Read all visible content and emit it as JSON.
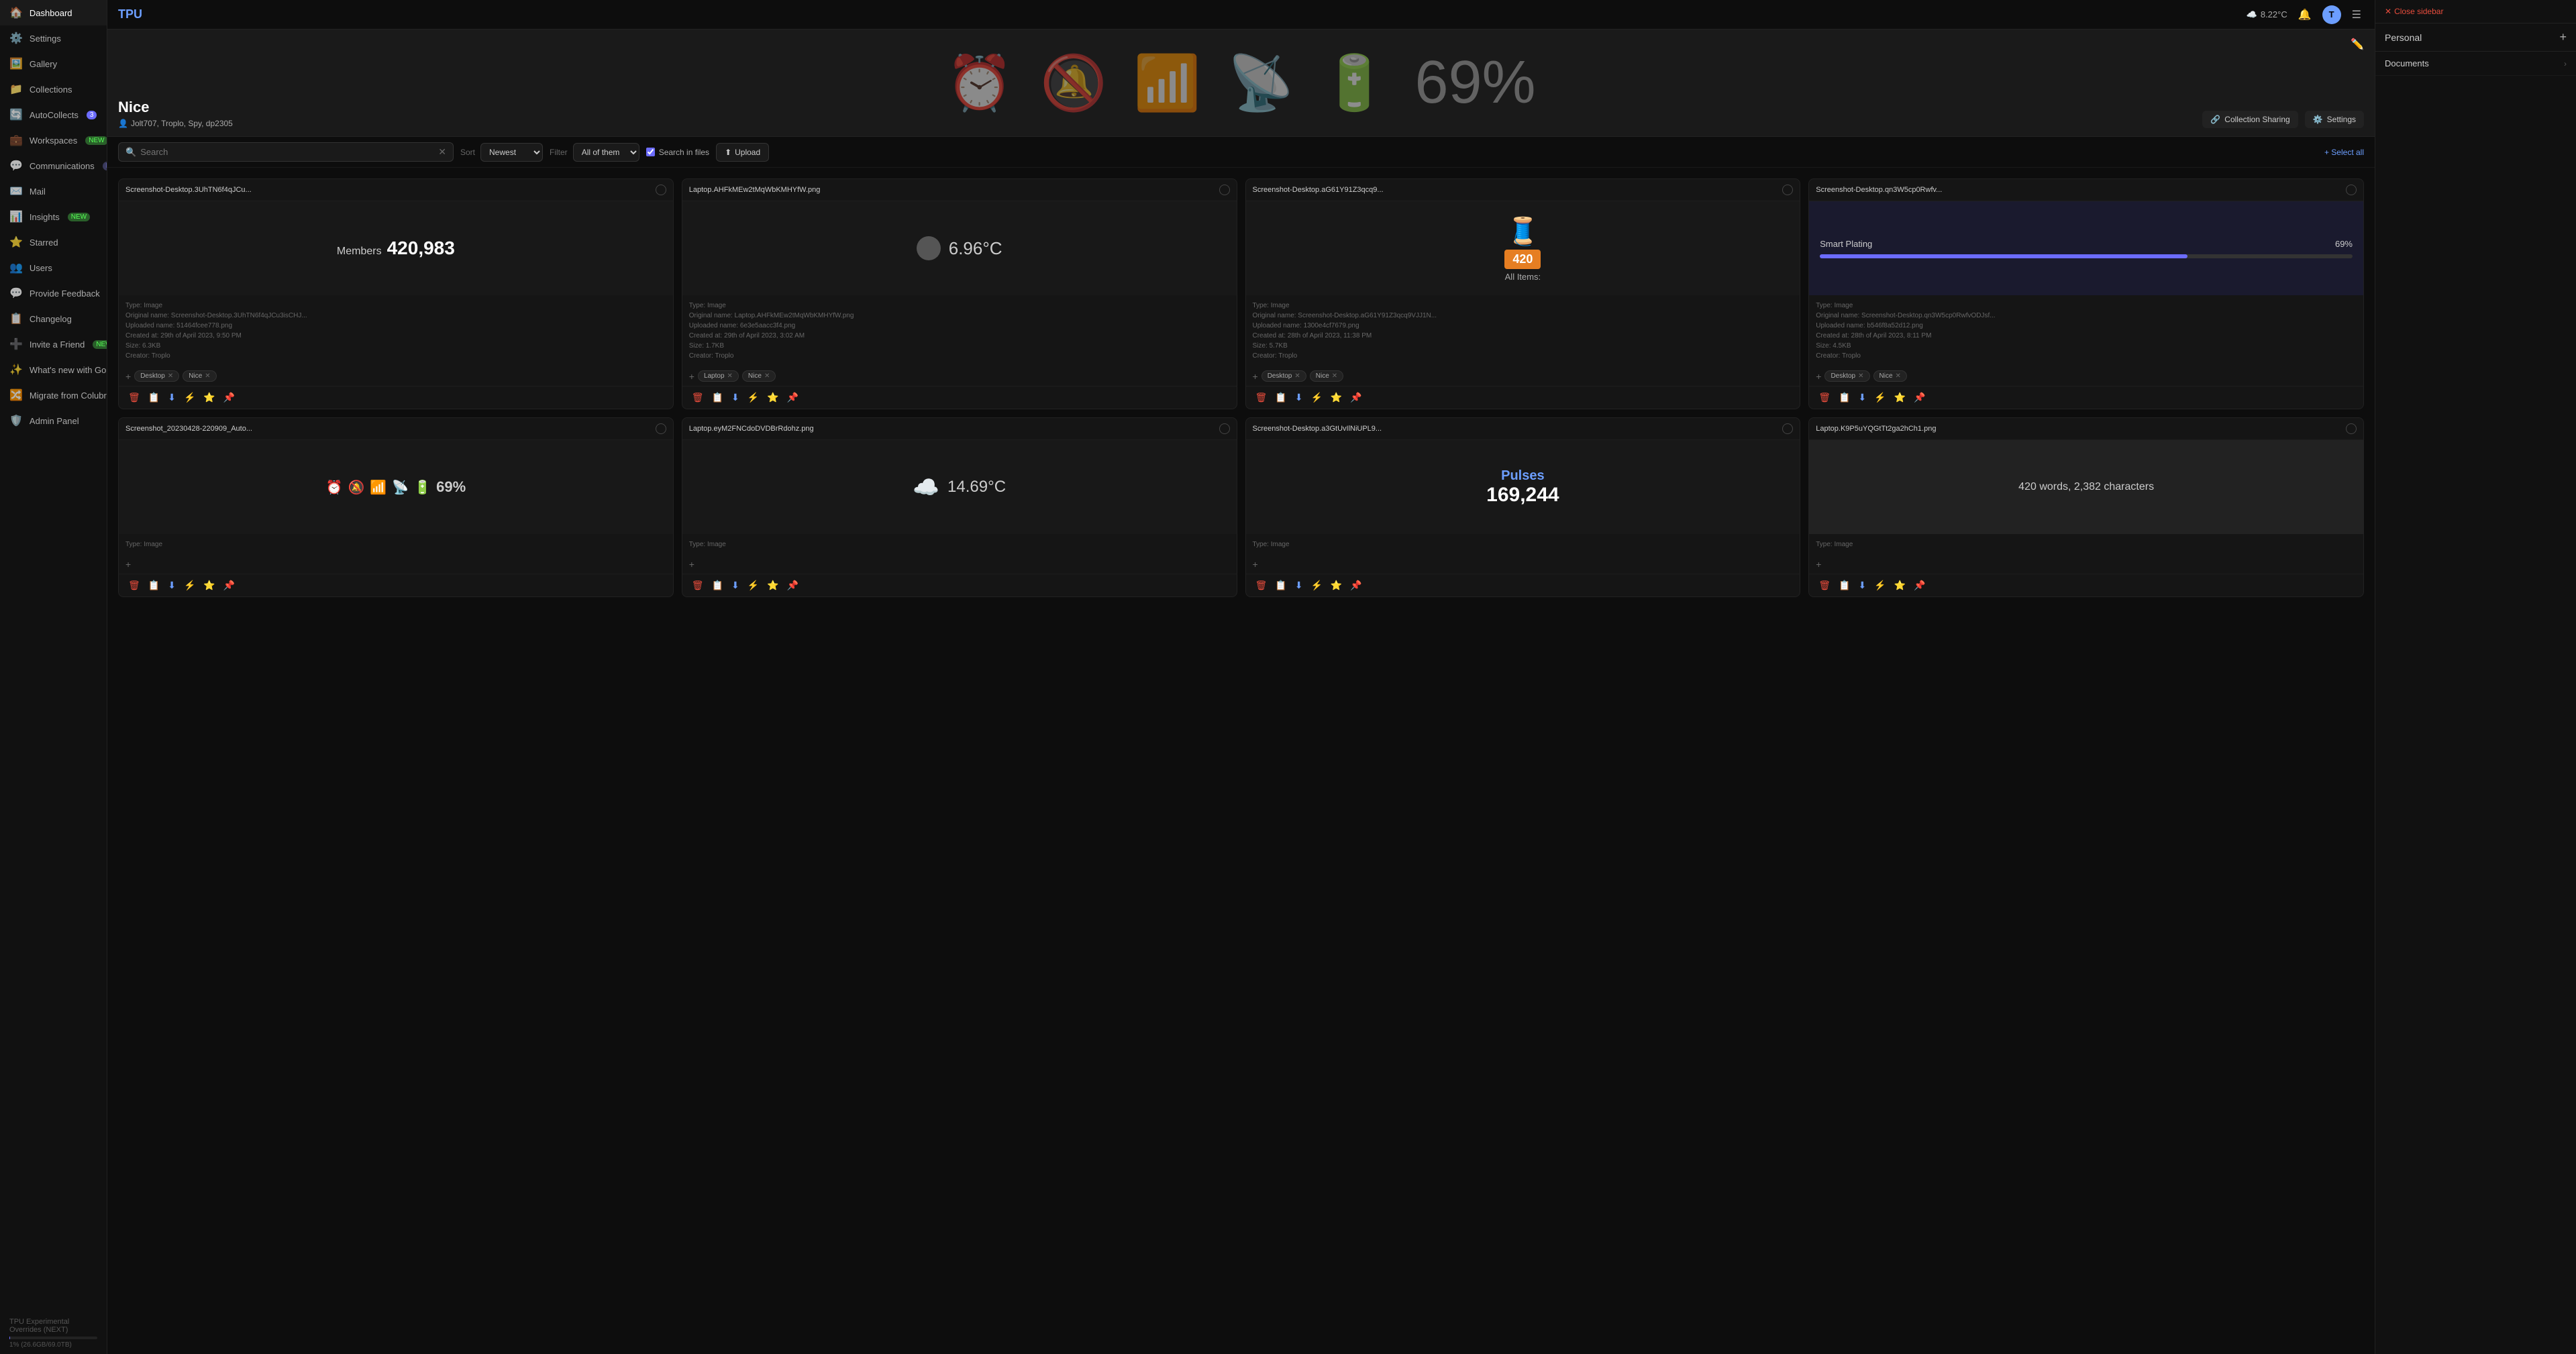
{
  "app": {
    "title": "TPU",
    "weather": "8.22°C"
  },
  "sidebar": {
    "items": [
      {
        "id": "dashboard",
        "label": "Dashboard",
        "icon": "🏠",
        "badge": null
      },
      {
        "id": "settings",
        "label": "Settings",
        "icon": "⚙️",
        "badge": null
      },
      {
        "id": "gallery",
        "label": "Gallery",
        "icon": "🖼️",
        "badge": null
      },
      {
        "id": "collections",
        "label": "Collections",
        "icon": "📁",
        "badge": null
      },
      {
        "id": "autocollects",
        "label": "AutoCollects",
        "icon": "🔄",
        "badge": "3"
      },
      {
        "id": "workspaces",
        "label": "Workspaces",
        "icon": "💼",
        "badge_new": "NEW"
      },
      {
        "id": "communications",
        "label": "Communications",
        "icon": "💬",
        "badge_beta": "BETA"
      },
      {
        "id": "mail",
        "label": "Mail",
        "icon": "✉️",
        "badge": null
      },
      {
        "id": "insights",
        "label": "Insights",
        "icon": "📊",
        "badge_new": "NEW"
      },
      {
        "id": "starred",
        "label": "Starred",
        "icon": "⭐",
        "badge": null
      },
      {
        "id": "users",
        "label": "Users",
        "icon": "👥",
        "badge": null
      },
      {
        "id": "feedback",
        "label": "Provide Feedback",
        "icon": "💬",
        "badge": null
      },
      {
        "id": "changelog",
        "label": "Changelog",
        "icon": "📋",
        "badge": null
      },
      {
        "id": "invite",
        "label": "Invite a Friend",
        "icon": "➕",
        "badge_new": "NEW"
      },
      {
        "id": "whats-new",
        "label": "What's new with Gold?",
        "icon": "✨",
        "badge": null
      },
      {
        "id": "migrate",
        "label": "Migrate from Colubrina",
        "icon": "🔀",
        "badge": null
      },
      {
        "id": "admin",
        "label": "Admin Panel",
        "icon": "🛡️",
        "badge": null
      }
    ],
    "footer": {
      "label": "TPU Experimental Overrides (NEXT)",
      "progress_label": "1% (26.6GB/69.0TB)"
    }
  },
  "collection": {
    "name": "Nice",
    "members": "Jolt707, Troplo, Spy, dp2305",
    "sharing_label": "Collection Sharing",
    "settings_label": "Settings"
  },
  "toolbar": {
    "search_placeholder": "Search",
    "sort_label": "Sort",
    "sort_value": "Newest",
    "filter_label": "Filter",
    "filter_value": "All of them",
    "search_in_files_label": "Search in files",
    "upload_label": "Upload",
    "select_all_label": "+ Select all"
  },
  "files": [
    {
      "id": "file-1",
      "title": "Screenshot-Desktop.3UhTN6f4qJCu...",
      "type": "Type: Image",
      "original": "Original name: Screenshot-Desktop.3UhTN6f4qJCu3isCHJ...",
      "uploaded": "Uploaded name: 51464fcee778.png",
      "created": "Created at: 29th of April 2023, 9:50 PM",
      "size": "Size: 6.3KB",
      "creator": "Creator: Troplo",
      "tags": [
        "Desktop",
        "Nice"
      ],
      "preview_type": "members",
      "preview_data": {
        "label": "Members",
        "value": "420,983"
      }
    },
    {
      "id": "file-2",
      "title": "Laptop.AHFkMEw2tMqWbKMHYfW.png",
      "type": "Type: Image",
      "original": "Original name: Laptop.AHFkMEw2tMqWbKMHYfW.png",
      "uploaded": "Uploaded name: 6e3e5aacc3f4.png",
      "created": "Created at: 29th of April 2023, 3:02 AM",
      "size": "Size: 1.7KB",
      "creator": "Creator: Troplo",
      "tags": [
        "Laptop",
        "Nice"
      ],
      "preview_type": "temp",
      "preview_data": {
        "value": "6.96°C"
      }
    },
    {
      "id": "file-3",
      "title": "Screenshot-Desktop.aG61Y91Z3qcq9...",
      "type": "Type: Image",
      "original": "Original name: Screenshot-Desktop.aG61Y91Z3qcq9VJJ1N...",
      "uploaded": "Uploaded name: 1300e4cf7679.png",
      "created": "Created at: 28th of April 2023, 11:38 PM",
      "size": "Size: 5.7KB",
      "creator": "Creator: Troplo",
      "tags": [
        "Desktop",
        "Nice"
      ],
      "preview_type": "spool",
      "preview_data": {
        "badge": "420",
        "label": "All Items:"
      }
    },
    {
      "id": "file-4",
      "title": "Screenshot-Desktop.qn3W5cp0Rwfv...",
      "type": "Type: Image",
      "original": "Original name: Screenshot-Desktop.qn3W5cp0RwfvODJsf...",
      "uploaded": "Uploaded name: b546f8a52d12.png",
      "created": "Created at: 28th of April 2023, 8:11 PM",
      "size": "Size: 4.5KB",
      "creator": "Creator: Troplo",
      "tags": [
        "Desktop",
        "Nice"
      ],
      "preview_type": "smart_plating",
      "preview_data": {
        "label": "Smart Plating",
        "value": "69%",
        "percent": 69
      }
    },
    {
      "id": "file-5",
      "title": "Screenshot_20230428-220909_Auto...",
      "type": "Type: Image",
      "original": "",
      "uploaded": "",
      "created": "",
      "size": "",
      "creator": "",
      "tags": [],
      "preview_type": "icons_row",
      "preview_data": {
        "icons": [
          "⏰",
          "🔕",
          "📶",
          "📶",
          "🔋"
        ],
        "percent": "69%"
      }
    },
    {
      "id": "file-6",
      "title": "Laptop.eyM2FNCdoDVDBrRdohz.png",
      "type": "Type: Image",
      "original": "",
      "uploaded": "",
      "created": "",
      "size": "",
      "creator": "",
      "tags": [],
      "preview_type": "cloud_temp",
      "preview_data": {
        "value": "14.69°C"
      }
    },
    {
      "id": "file-7",
      "title": "Screenshot-Desktop.a3GtUvIlNiUPL9...",
      "type": "Type: Image",
      "original": "",
      "uploaded": "",
      "created": "",
      "size": "",
      "creator": "",
      "tags": [],
      "preview_type": "pulses",
      "preview_data": {
        "label": "Pulses",
        "value": "169,244"
      }
    },
    {
      "id": "file-8",
      "title": "Laptop.K9P5uYQGtTt2ga2hCh1.png",
      "type": "Type: Image",
      "original": "",
      "uploaded": "",
      "created": "",
      "size": "",
      "creator": "",
      "tags": [],
      "preview_type": "words",
      "preview_data": {
        "value": "420 words, 2,382 characters"
      }
    }
  ],
  "right_sidebar": {
    "close_label": "Close sidebar",
    "add_label": "+",
    "title": "Personal",
    "folders": [
      {
        "name": "Documents",
        "has_chevron": true
      }
    ]
  },
  "colors": {
    "accent": "#6c6cff",
    "accent_blue": "#6c9eff",
    "danger": "#e74c3c"
  }
}
